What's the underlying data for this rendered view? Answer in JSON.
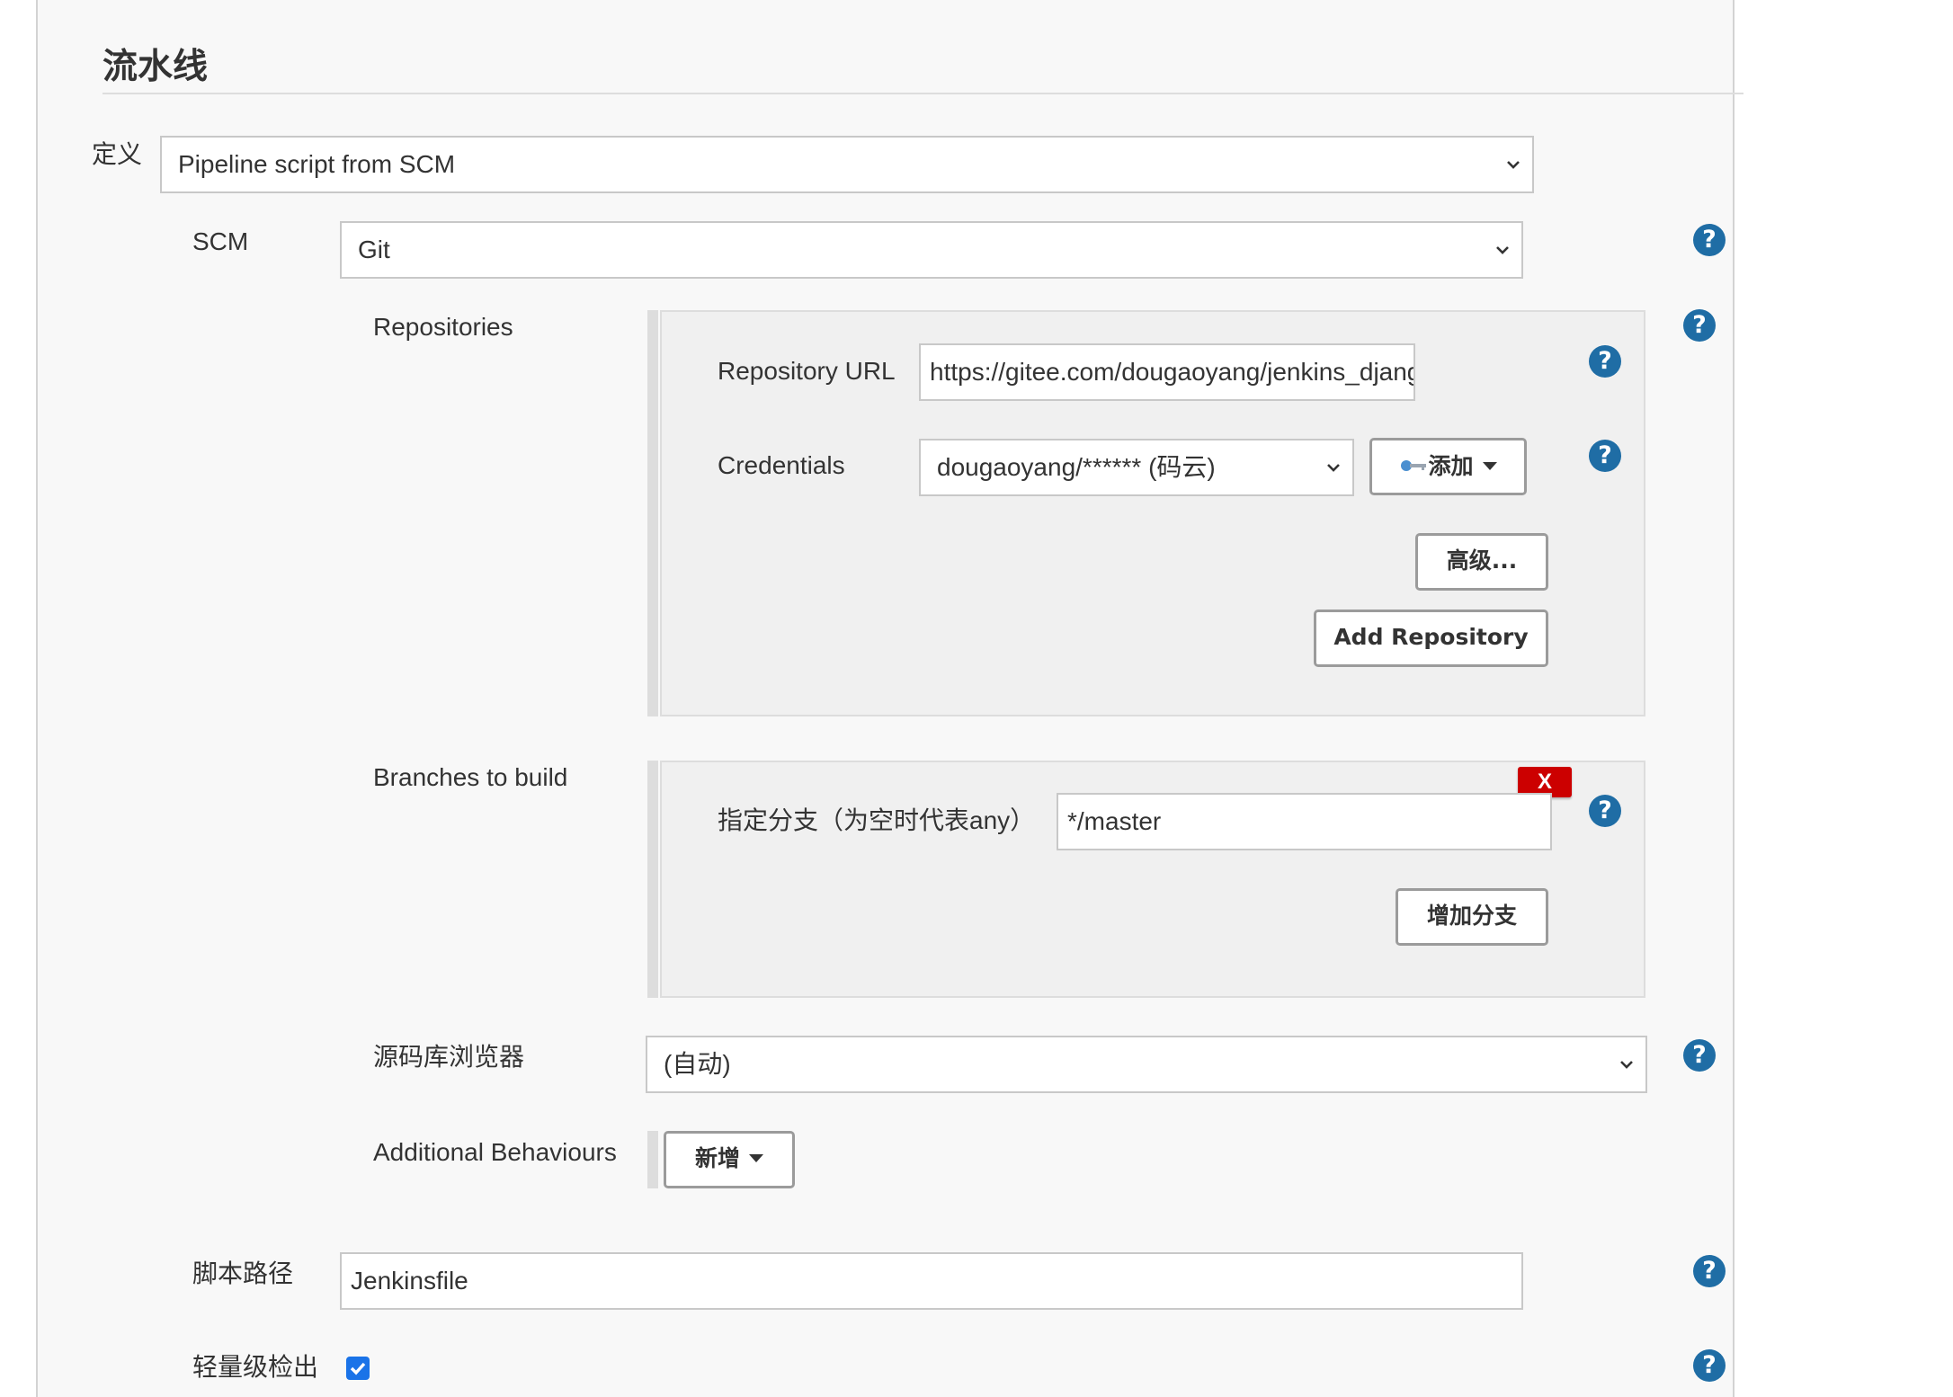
{
  "section": {
    "title": "流水线"
  },
  "definition": {
    "label": "定义",
    "selected": "Pipeline script from SCM"
  },
  "scm": {
    "label": "SCM",
    "selected": "Git"
  },
  "repositories": {
    "label": "Repositories",
    "url_label": "Repository URL",
    "url_value": "https://gitee.com/dougaoyang/jenkins_django.git",
    "credentials_label": "Credentials",
    "credentials_selected": "dougaoyang/****** (码云)",
    "add_button": "添加",
    "advanced_button": "高级...",
    "add_repository_button": "Add Repository"
  },
  "branches": {
    "label": "Branches to build",
    "branch_label": "指定分支（为空时代表any）",
    "branch_value": "*/master",
    "delete_label": "X",
    "add_branch_button": "增加分支"
  },
  "browser": {
    "label": "源码库浏览器",
    "selected": "(自动)"
  },
  "behaviours": {
    "label": "Additional Behaviours",
    "add_button": "新增"
  },
  "script_path": {
    "label": "脚本路径",
    "value": "Jenkinsfile"
  },
  "lightweight": {
    "label": "轻量级检出",
    "checked": true
  },
  "help": {
    "symbol": "?"
  },
  "colors": {
    "help": "#1f6da5",
    "delete": "#cc0000",
    "checkbox": "#1a73e8"
  },
  "icons": {
    "select_arrow": "chevron-down-icon",
    "credentials_add": "key-icon",
    "dropdown": "caret-down-icon",
    "help": "question-icon",
    "check": "check-icon"
  }
}
